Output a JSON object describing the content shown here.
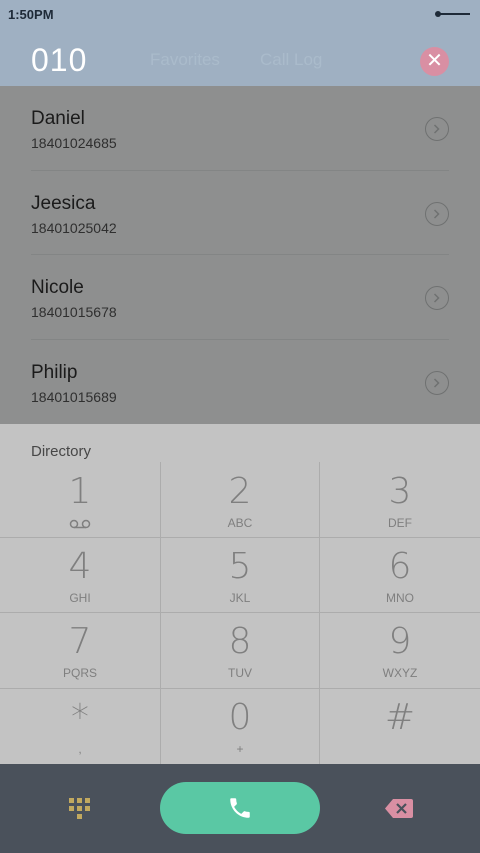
{
  "status_bar": {
    "time": "1:50PM"
  },
  "header": {
    "dialed_number": "010",
    "ghost_tabs": [
      "Favorites",
      "Call Log"
    ]
  },
  "contacts": [
    {
      "name": "Daniel",
      "phone": "18401024685"
    },
    {
      "name": "Jeesica",
      "phone": "18401025042"
    },
    {
      "name": "Nicole",
      "phone": "18401015678"
    },
    {
      "name": "Philip",
      "phone": "18401015689"
    }
  ],
  "keypad": {
    "section_label": "Directory",
    "keys": [
      {
        "digit": "1",
        "letters": ""
      },
      {
        "digit": "2",
        "letters": "ABC"
      },
      {
        "digit": "3",
        "letters": "DEF"
      },
      {
        "digit": "4",
        "letters": "GHI"
      },
      {
        "digit": "5",
        "letters": "JKL"
      },
      {
        "digit": "6",
        "letters": "MNO"
      },
      {
        "digit": "7",
        "letters": "PQRS"
      },
      {
        "digit": "8",
        "letters": "TUV"
      },
      {
        "digit": "9",
        "letters": "WXYZ"
      },
      {
        "digit": "*",
        "letters": ","
      },
      {
        "digit": "0",
        "letters": "+"
      },
      {
        "digit": "#",
        "letters": ""
      }
    ]
  },
  "icons": {
    "voicemail": "voicemail-icon",
    "keypad": "keypad-grid-icon",
    "call": "phone-icon",
    "backspace": "backspace-icon",
    "clear": "clear-icon",
    "detail": "chevron-right-icon"
  },
  "colors": {
    "header": "#9fb0c2",
    "call_button": "#5ac8a4",
    "backspace": "#d98fa3",
    "clear": "#d98fa3",
    "keypad_toggle": "#c2a95f",
    "bottom_bar": "#4a515b"
  }
}
